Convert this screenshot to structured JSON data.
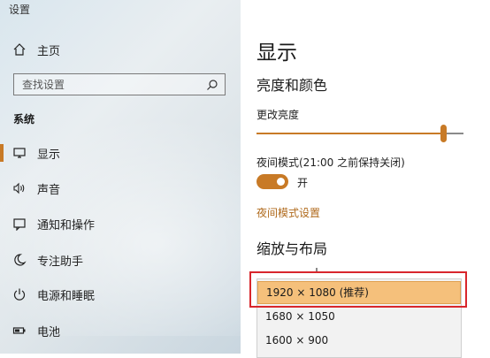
{
  "window": {
    "title": "设置"
  },
  "sidebar": {
    "home_label": "主页",
    "search_placeholder": "查找设置",
    "section_label": "系统",
    "items": [
      {
        "label": "显示",
        "icon": "monitor-icon",
        "active": true
      },
      {
        "label": "声音",
        "icon": "speaker-icon",
        "active": false
      },
      {
        "label": "通知和操作",
        "icon": "notification-icon",
        "active": false
      },
      {
        "label": "专注助手",
        "icon": "moon-icon",
        "active": false
      },
      {
        "label": "电源和睡眠",
        "icon": "power-icon",
        "active": false
      },
      {
        "label": "电池",
        "icon": "battery-icon",
        "active": false
      }
    ]
  },
  "main": {
    "title": "显示",
    "brightness_section": "亮度和颜色",
    "brightness_label": "更改亮度",
    "brightness_value": 0.9,
    "night_light_label": "夜间模式(21:00 之前保持关闭)",
    "night_light_state": "开",
    "night_light_link": "夜间模式设置",
    "scale_section": "缩放与布局",
    "resolution_options": [
      "1920 × 1080 (推荐)",
      "1680 × 1050",
      "1600 × 900"
    ],
    "resolution_selected": 0
  },
  "colors": {
    "accent": "#c87a26",
    "highlight_border": "#d8262c",
    "selected_option": "#f5c07b"
  }
}
